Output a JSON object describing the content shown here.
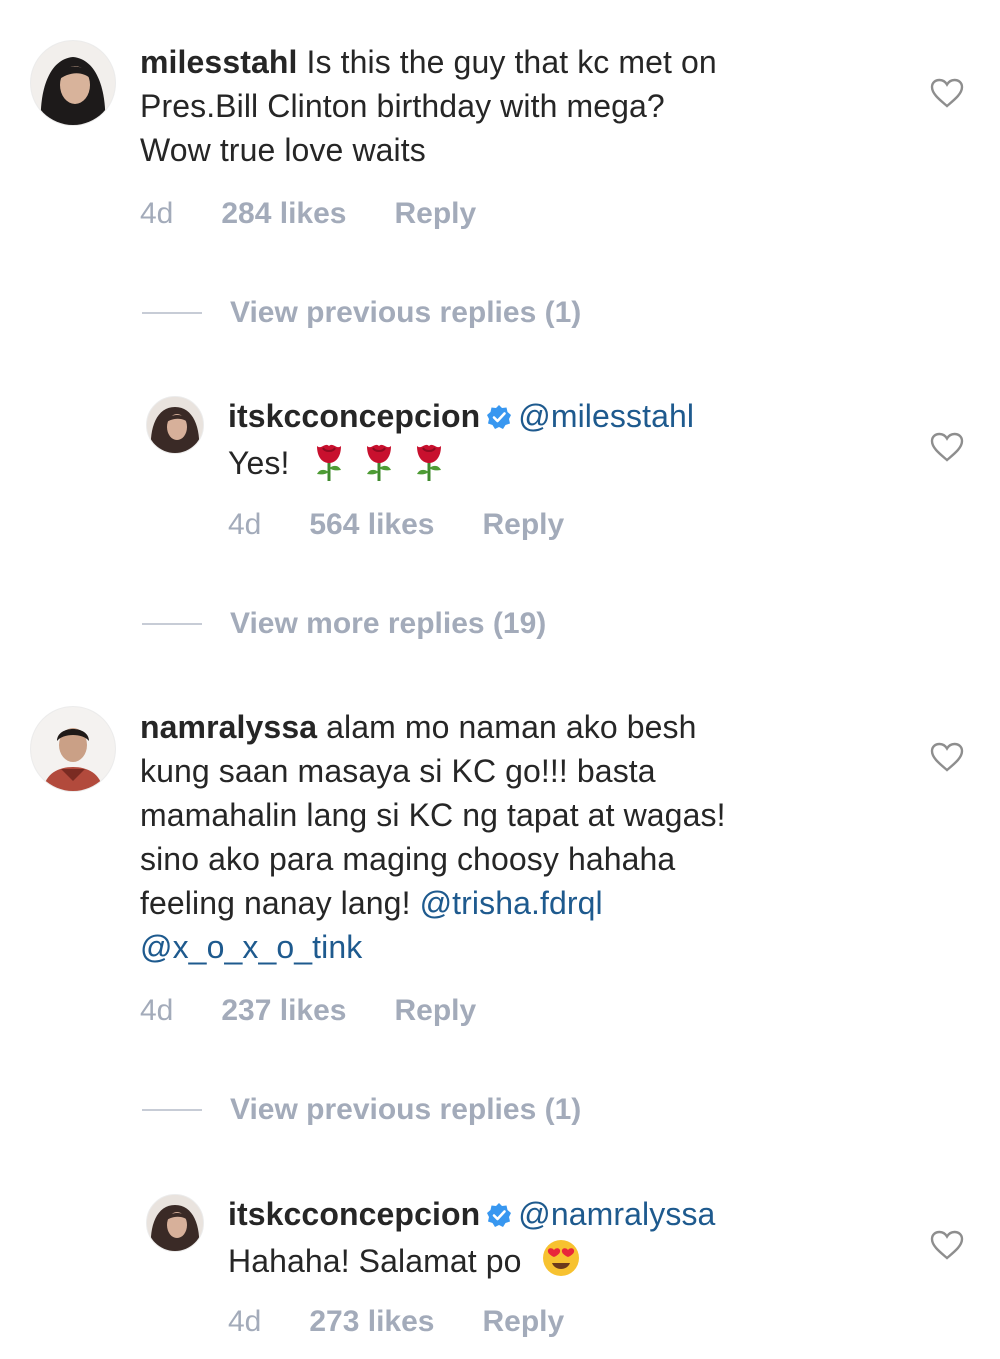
{
  "threads": [
    {
      "username": "milesstahl",
      "text_line1": "Is this the guy that kc met on",
      "text_line2": "Pres.Bill Clinton birthday with mega?",
      "text_line3": "Wow true love waits",
      "age": "4d",
      "likes": "284 likes",
      "reply_label": "Reply",
      "view_replies": "View previous replies (1)",
      "reply": {
        "username": "itskcconcepcion",
        "mention": "@milesstahl",
        "text": "Yes!",
        "age": "4d",
        "likes": "564 likes",
        "reply_label": "Reply"
      },
      "view_more": "View more replies (19)"
    },
    {
      "username": "namralyssa",
      "text_line1": "alam mo naman ako besh",
      "text_line2": "kung saan masaya si KC go!!! basta",
      "text_line3": "mamahalin lang si KC ng tapat at wagas!",
      "text_line4": "sino ako para maging choosy hahaha",
      "text_line5": "feeling nanay lang!",
      "mention1": "@trisha.fdrql",
      "mention2": "@x_o_x_o_tink",
      "age": "4d",
      "likes": "237 likes",
      "reply_label": "Reply",
      "view_replies": "View previous replies (1)",
      "reply": {
        "username": "itskcconcepcion",
        "mention": "@namralyssa",
        "text": "Hahaha! Salamat po",
        "age": "4d",
        "likes": "273 likes",
        "reply_label": "Reply"
      }
    }
  ],
  "icons": {
    "heart": "heart-outline-icon",
    "verified": "verified-badge-icon",
    "rose": "rose-emoji",
    "heart_eyes": "heart-eyes-emoji"
  },
  "colors": {
    "text": "#262626",
    "meta": "#a3abba",
    "mention": "#1e5a8e",
    "verified": "#3897f0"
  }
}
